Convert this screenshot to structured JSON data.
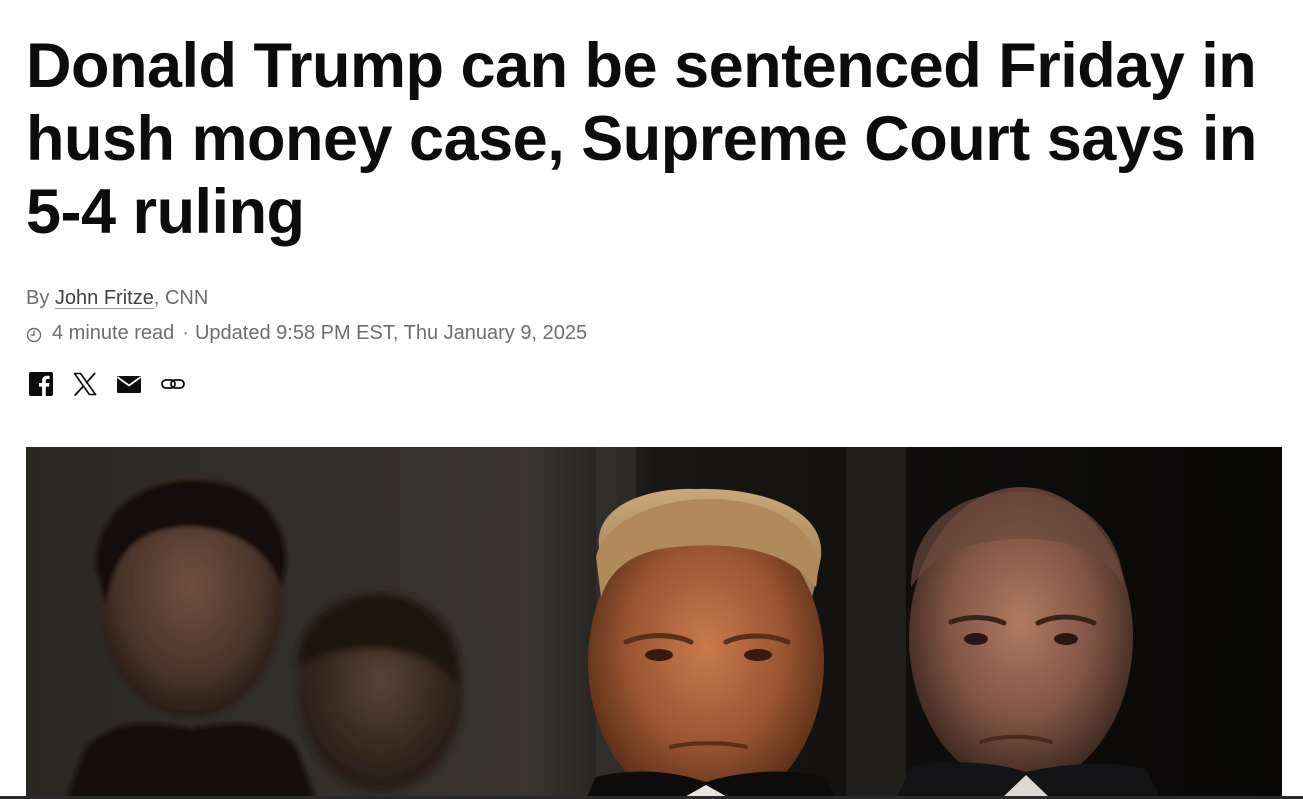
{
  "article": {
    "headline": "Donald Trump can be sentenced Friday in hush money case, Supreme Court says in 5-4 ruling",
    "byline_prefix": "By ",
    "author": "John Fritze",
    "byline_suffix": ", CNN",
    "read_time": "4 minute read",
    "separator": "·",
    "updated": "Updated 9:58 PM EST, Thu January 9, 2025"
  },
  "share": {
    "icons": [
      "facebook-icon",
      "x-icon",
      "email-icon",
      "link-icon"
    ]
  },
  "colors": {
    "headline": "#0c0c0c",
    "meta": "#6e6e6e",
    "author": "#404040",
    "hero_bg": "#0b0a09"
  }
}
